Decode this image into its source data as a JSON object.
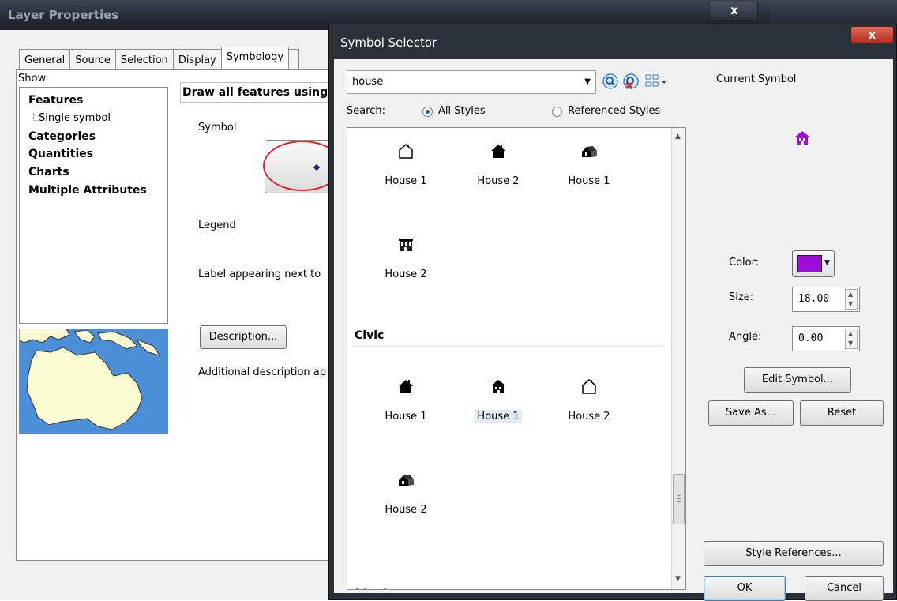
{
  "layer_properties": {
    "title": "Layer Properties",
    "close": "x",
    "tabs": [
      "General",
      "Source",
      "Selection",
      "Display",
      "Symbology"
    ],
    "show_label": "Show:",
    "show_items": {
      "features": "Features",
      "single_symbol": "Single symbol",
      "categories": "Categories",
      "quantities": "Quantities",
      "charts": "Charts",
      "multiple_attributes": "Multiple Attributes"
    },
    "draw_heading": "Draw all features using",
    "symbol_label": "Symbol",
    "legend_label": "Legend",
    "label_text": "Label appearing next to",
    "description_button": "Description...",
    "additional_text": "Additional description ap"
  },
  "symbol_selector": {
    "title": "Symbol Selector",
    "close": "x",
    "search": {
      "value": "house",
      "label": "Search:",
      "all_styles": "All Styles",
      "referenced_styles": "Referenced Styles"
    },
    "groups": [
      {
        "name": "",
        "items": [
          {
            "label": "House 1",
            "icon": "house-outline-icon"
          },
          {
            "label": "House 2",
            "icon": "house-solid-icon"
          },
          {
            "label": "House 1",
            "icon": "house-3d-icon"
          },
          {
            "label": "House 2",
            "icon": "house-building-icon"
          }
        ]
      },
      {
        "name": "Civic",
        "items": [
          {
            "label": "House 1",
            "icon": "house-solid-icon"
          },
          {
            "label": "House 1",
            "icon": "house-windows-icon",
            "selected": true
          },
          {
            "label": "House 2",
            "icon": "house-outline-icon"
          },
          {
            "label": "House 2",
            "icon": "house-3d-icon"
          }
        ]
      }
    ],
    "current_symbol_label": "Current Symbol",
    "current_symbol_color": "#9c0fd8",
    "color_label": "Color:",
    "size_label": "Size:",
    "size_value": "18.00",
    "angle_label": "Angle:",
    "angle_value": "0.00",
    "buttons": {
      "edit_symbol": "Edit Symbol...",
      "save_as": "Save As...",
      "reset": "Reset",
      "style_references": "Style References...",
      "ok": "OK",
      "cancel": "Cancel"
    }
  },
  "annotation_color": "#e0262b"
}
